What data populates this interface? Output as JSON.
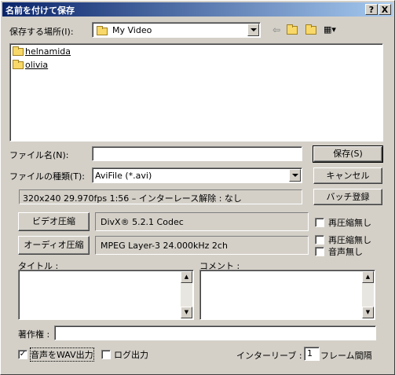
{
  "window": {
    "title": "名前を付けて保存",
    "help": "?",
    "close": "X"
  },
  "location": {
    "label": "保存する場所(I):",
    "value": "My Video"
  },
  "files": [
    {
      "name": "helnamida"
    },
    {
      "name": "olivia"
    }
  ],
  "filename": {
    "label": "ファイル名(N):",
    "value": ""
  },
  "filetype": {
    "label": "ファイルの種類(T):",
    "value": "AviFile (*.avi)"
  },
  "buttons": {
    "save": "保存(S)",
    "cancel": "キャンセル",
    "batch": "バッチ登録",
    "video_compress": "ビデオ圧縮",
    "audio_compress": "オーディオ圧縮"
  },
  "info": "320x240  29.970fps  1:56  –  インターレース解除 : なし",
  "video_codec": "DivX® 5.2.1 Codec",
  "audio_codec": "MPEG Layer-3 24.000kHz 2ch",
  "options": {
    "video_no_recompress": "再圧縮無し",
    "audio_no_recompress": "再圧縮無し",
    "no_audio": "音声無し",
    "wav_output": "音声をWAV出力",
    "log_output": "ログ出力"
  },
  "checks": {
    "video_no_recompress": false,
    "audio_no_recompress": false,
    "no_audio": false,
    "wav_output": true,
    "log_output": false
  },
  "title_field": {
    "label": "タイトル :",
    "value": ""
  },
  "comment_field": {
    "label": "コメント :",
    "value": ""
  },
  "copyright": {
    "label": "著作権 :",
    "value": ""
  },
  "interleave": {
    "label": "インターリーブ :",
    "value": "1",
    "unit": "フレーム間隔"
  }
}
